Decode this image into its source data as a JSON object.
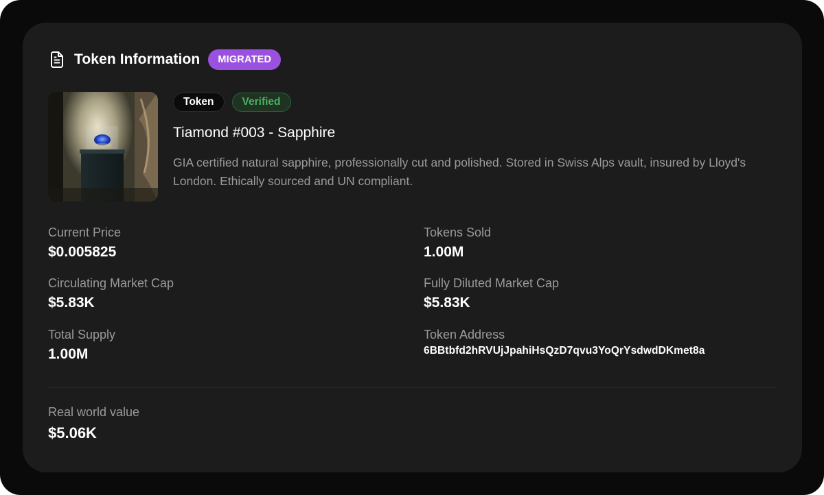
{
  "header": {
    "title": "Token Information",
    "status_badge": "MIGRATED",
    "icon": "document-icon"
  },
  "token": {
    "image_alt": "sapphire-display-icon",
    "tags": [
      "Token",
      "Verified"
    ],
    "name": "Tiamond #003 - Sapphire",
    "description": "GIA certified natural sapphire, professionally cut and polished. Stored in Swiss Alps vault, insured by Lloyd's London. Ethically sourced and UN compliant."
  },
  "stats": {
    "current_price": {
      "label": "Current Price",
      "value": "$0.005825"
    },
    "tokens_sold": {
      "label": "Tokens Sold",
      "value": "1.00M"
    },
    "circulating_market_cap": {
      "label": "Circulating Market Cap",
      "value": "$5.83K"
    },
    "fully_diluted_market_cap": {
      "label": "Fully Diluted Market Cap",
      "value": "$5.83K"
    },
    "total_supply": {
      "label": "Total Supply",
      "value": "1.00M"
    },
    "token_address": {
      "label": "Token Address",
      "value": "6BBtbfd2hRVUjJpahiHsQzD7qvu3YoQrYsdwdDKmet8a"
    }
  },
  "real_world": {
    "label": "Real world value",
    "value": "$5.06K"
  },
  "colors": {
    "card_bg": "#1c1c1c",
    "migrated_badge": "#9b51e0",
    "verified_text": "#4bb062"
  }
}
